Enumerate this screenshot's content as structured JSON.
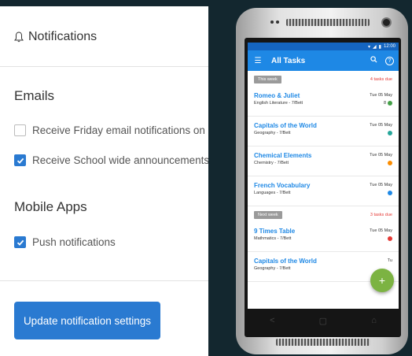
{
  "settings": {
    "header": "Notifications",
    "emails_title": "Emails",
    "email_options": [
      {
        "label": "Receive Friday email notifications on homework",
        "checked": false
      },
      {
        "label": "Receive School wide announcements via email",
        "checked": true
      }
    ],
    "mobile_title": "Mobile Apps",
    "mobile_options": [
      {
        "label": "Push notifications",
        "checked": true
      }
    ],
    "update_button": "Update notification settings",
    "accent_color": "#2a7ad1"
  },
  "phone": {
    "status_time": "12:00",
    "app_title": "All Tasks",
    "this_week": {
      "badge": "This week",
      "due": "4 tasks due",
      "tasks": [
        {
          "title": "Romeo & Juliet",
          "subtitle": "English Literature - 7/Bett",
          "date": "Tue 05 May",
          "status_color": "#43a047",
          "extra": "8"
        },
        {
          "title": "Capitals of the World",
          "subtitle": "Geography - 7/Bett",
          "date": "Tue 05 May",
          "status_color": "#26a69a"
        },
        {
          "title": "Chemical Elements",
          "subtitle": "Chemistry - 7/Bett",
          "date": "Tue 05 May",
          "status_color": "#fb8c00"
        },
        {
          "title": "French Vocabulary",
          "subtitle": "Languages - 7/Bett",
          "date": "Tue 05 May",
          "status_color": "#1e88e5"
        }
      ]
    },
    "next_week": {
      "badge": "Next week",
      "due": "3 tasks due",
      "tasks": [
        {
          "title": "9 Times Table",
          "subtitle": "Mathmatics - 7/Bett",
          "date": "Tue 05 May",
          "status_color": "#e53935"
        },
        {
          "title": "Capitals of the World",
          "subtitle": "Geography - 7/Bett",
          "date": "Tu",
          "status_color": "#26a69a"
        }
      ]
    },
    "fab_label": "+",
    "app_bar_color": "#1e88e5"
  }
}
